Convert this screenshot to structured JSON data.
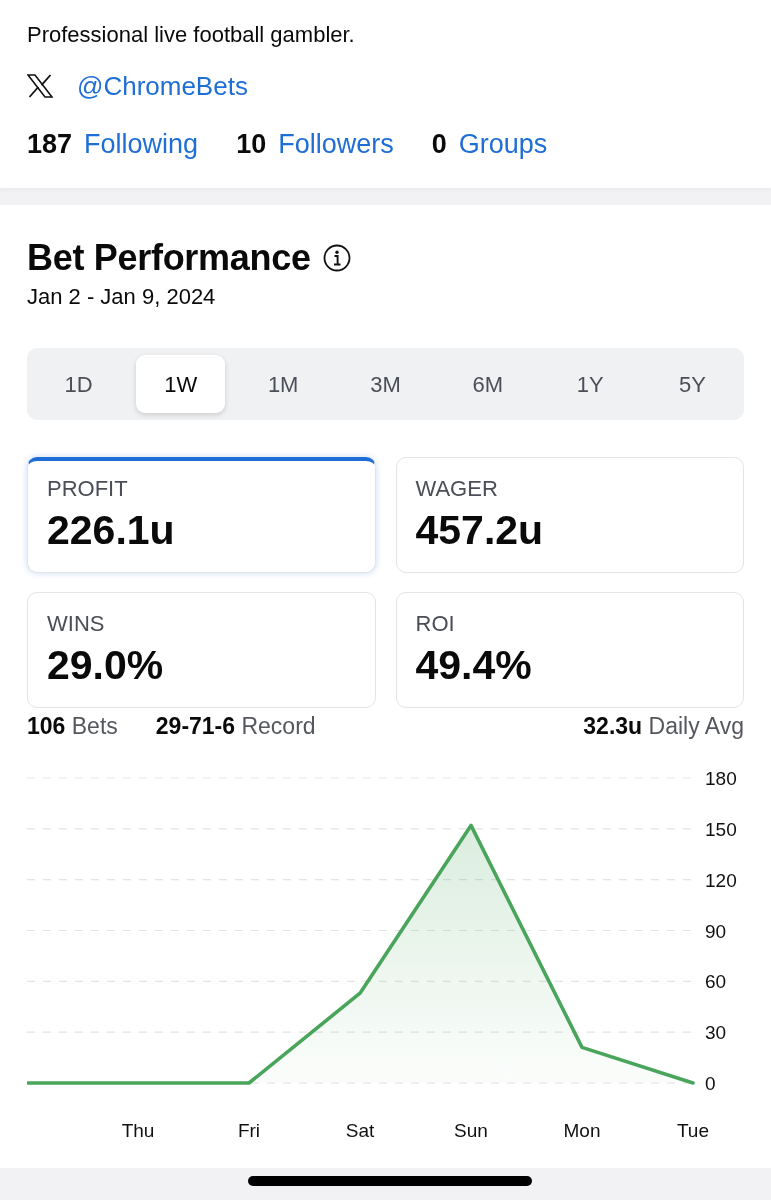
{
  "profile": {
    "bio": "Professional live football gambler.",
    "handle": "@ChromeBets",
    "stats": [
      {
        "count": "187",
        "label": "Following"
      },
      {
        "count": "10",
        "label": "Followers"
      },
      {
        "count": "0",
        "label": "Groups"
      }
    ]
  },
  "performance": {
    "title": "Bet Performance",
    "date_range": "Jan 2 - Jan 9, 2024",
    "ranges": [
      {
        "label": "1D",
        "selected": false
      },
      {
        "label": "1W",
        "selected": true
      },
      {
        "label": "1M",
        "selected": false
      },
      {
        "label": "3M",
        "selected": false
      },
      {
        "label": "6M",
        "selected": false
      },
      {
        "label": "1Y",
        "selected": false
      },
      {
        "label": "5Y",
        "selected": false
      }
    ],
    "metrics": [
      {
        "label": "PROFIT",
        "value": "226.1u",
        "selected": true
      },
      {
        "label": "WAGER",
        "value": "457.2u",
        "selected": false
      },
      {
        "label": "WINS",
        "value": "29.0%",
        "selected": false
      },
      {
        "label": "ROI",
        "value": "49.4%",
        "selected": false
      }
    ],
    "summary": [
      "**106** Bets",
      "**29-71-6** Record",
      "**32.3u** Daily Avg"
    ],
    "chart_data": {
      "type": "area",
      "categories": [
        null,
        "Thu",
        "Fri",
        "Sat",
        "Sun",
        "Mon",
        "Tue"
      ],
      "values": [
        0,
        0,
        0,
        53,
        152,
        21,
        0
      ],
      "ylim": [
        0,
        180
      ],
      "yticks": [
        0,
        30,
        60,
        90,
        120,
        150,
        180
      ],
      "grid": true
    }
  }
}
